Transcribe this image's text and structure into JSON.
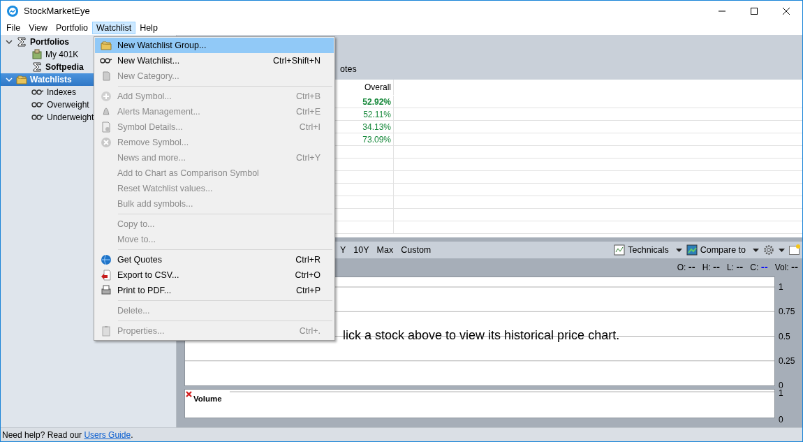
{
  "window": {
    "title": "StockMarketEye"
  },
  "menubar": [
    {
      "label": "File",
      "selected": false
    },
    {
      "label": "View",
      "selected": false
    },
    {
      "label": "Portfolio",
      "selected": false
    },
    {
      "label": "Watchlist",
      "selected": true
    },
    {
      "label": "Help",
      "selected": false
    }
  ],
  "sidebar": {
    "items": [
      {
        "label": "Portfolios",
        "kind": "portfolios",
        "bold": true,
        "selected": false,
        "expanded": true,
        "children": [
          {
            "label": "My 401K",
            "kind": "portfolio",
            "bold": false,
            "selected": false
          },
          {
            "label": "Softpedia",
            "kind": "composite",
            "bold": true,
            "selected": false
          }
        ]
      },
      {
        "label": "Watchlists",
        "kind": "watchlists",
        "bold": true,
        "selected": true,
        "expanded": true,
        "children": [
          {
            "label": "Indexes",
            "kind": "watchlist",
            "bold": false,
            "selected": false
          },
          {
            "label": "Overweight",
            "kind": "watchlist",
            "bold": false,
            "selected": false
          },
          {
            "label": "Underweight",
            "kind": "watchlist",
            "bold": false,
            "selected": false
          }
        ]
      }
    ]
  },
  "header": {
    "label": "otes"
  },
  "table": {
    "columns": [
      "Overall"
    ],
    "rows": [
      {
        "overall": "52.92%",
        "total": true
      },
      {
        "overall": "52.11%",
        "total": false
      },
      {
        "overall": "34.13%",
        "total": false
      },
      {
        "overall": "73.09%",
        "total": false
      }
    ]
  },
  "chart_toolbar": {
    "ranges": [
      "Y",
      "10Y",
      "Max",
      "Custom"
    ],
    "tools": [
      {
        "label": "Technicals",
        "kind": "technicals"
      },
      {
        "label": "Compare to",
        "kind": "compare"
      }
    ]
  },
  "ohlc": [
    {
      "label": "O:",
      "value": "--",
      "color": "#000000"
    },
    {
      "label": "H:",
      "value": "--",
      "color": "#000000"
    },
    {
      "label": "L:",
      "value": "--",
      "color": "#000000"
    },
    {
      "label": "C:",
      "value": "--",
      "color": "#0000ff"
    },
    {
      "label": "Vol:",
      "value": "--",
      "color": "#000000"
    }
  ],
  "price_chart": {
    "message": "lick a stock above to view its historical price chart.",
    "axis_labels": [
      "1",
      "0.75",
      "0.5",
      "0.25",
      "0"
    ]
  },
  "volume_chart": {
    "title": "Volume",
    "axis_labels": [
      "1",
      "0"
    ]
  },
  "menu": {
    "items": [
      {
        "kind": "item",
        "label": "New Watchlist Group...",
        "selected": true,
        "disabled": false
      },
      {
        "kind": "item",
        "label": "New Watchlist...",
        "shortcut": "Ctrl+Shift+N",
        "selected": false,
        "disabled": false
      },
      {
        "kind": "item",
        "label": "New Category...",
        "selected": false,
        "disabled": true
      },
      {
        "kind": "separator"
      },
      {
        "kind": "item",
        "label": "Add Symbol...",
        "shortcut": "Ctrl+B",
        "selected": false,
        "disabled": true
      },
      {
        "kind": "item",
        "label": "Alerts Management...",
        "shortcut": "Ctrl+E",
        "selected": false,
        "disabled": true
      },
      {
        "kind": "item",
        "label": "Symbol Details...",
        "shortcut": "Ctrl+I",
        "selected": false,
        "disabled": true
      },
      {
        "kind": "item",
        "label": "Remove Symbol...",
        "selected": false,
        "disabled": true
      },
      {
        "kind": "item",
        "label": "News and more...",
        "shortcut": "Ctrl+Y",
        "selected": false,
        "disabled": true
      },
      {
        "kind": "item",
        "label": "Add to Chart as Comparison Symbol",
        "selected": false,
        "disabled": true
      },
      {
        "kind": "item",
        "label": "Reset Watchlist values...",
        "selected": false,
        "disabled": true
      },
      {
        "kind": "item",
        "label": "Bulk add symbols...",
        "selected": false,
        "disabled": true
      },
      {
        "kind": "separator"
      },
      {
        "kind": "item",
        "label": "Copy to...",
        "selected": false,
        "disabled": true
      },
      {
        "kind": "item",
        "label": "Move to...",
        "selected": false,
        "disabled": true
      },
      {
        "kind": "separator"
      },
      {
        "kind": "item",
        "label": "Get Quotes",
        "shortcut": "Ctrl+R",
        "selected": false,
        "disabled": false
      },
      {
        "kind": "item",
        "label": "Export to CSV...",
        "shortcut": "Ctrl+O",
        "selected": false,
        "disabled": false
      },
      {
        "kind": "item",
        "label": "Print to PDF...",
        "shortcut": "Ctrl+P",
        "selected": false,
        "disabled": false
      },
      {
        "kind": "separator"
      },
      {
        "kind": "item",
        "label": "Delete...",
        "selected": false,
        "disabled": true
      },
      {
        "kind": "separator"
      },
      {
        "kind": "item",
        "label": "Properties...",
        "shortcut": "Ctrl+.",
        "selected": false,
        "disabled": true
      }
    ]
  },
  "status_bar": {
    "text": "Need help? Read our ",
    "link": "Users Guide",
    "after": "."
  }
}
